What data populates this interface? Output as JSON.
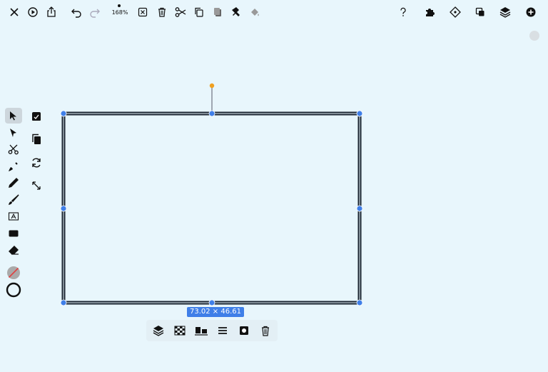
{
  "toolbar": {
    "zoom_label": "168%",
    "left_icons": [
      "close-icon",
      "play-icon",
      "share-icon"
    ],
    "history_icons": [
      "undo-icon",
      "redo-icon"
    ],
    "edit_icons": [
      "delete-selection-icon",
      "trash-icon",
      "scissors-icon",
      "copy-icon",
      "paste-icon",
      "stamp-icon",
      "fill-bucket-icon"
    ],
    "right_icons": [
      "help-icon",
      "puzzle-icon",
      "snap-icon",
      "arrange-icon",
      "layers-icon",
      "add-icon"
    ]
  },
  "tools": {
    "main": [
      "select-arrow-icon",
      "direct-select-icon",
      "scissors-tool-icon",
      "pen-tool-icon",
      "pencil-tool-icon",
      "brush-tool-icon",
      "text-tool-icon",
      "rectangle-tool-icon",
      "eraser-tool-icon"
    ],
    "selected": "select-arrow-icon",
    "secondary": [
      "store-icon",
      "duplicate-icon",
      "rotate-icon",
      "resize-icon"
    ],
    "fill_color": "none",
    "stroke_color": "#111111"
  },
  "selection": {
    "dimensions_label": "73.02 × 46.61",
    "handle_color": "#3f7fe8",
    "rotate_handle_color": "#f0a020"
  },
  "shape": {
    "type": "rectangle",
    "stroke_color": "#1a2430"
  },
  "context_bar": {
    "icons": [
      "layer-order-icon",
      "transparency-icon",
      "align-icon",
      "distribute-icon",
      "mask-icon",
      "delete-icon"
    ]
  },
  "colors": {
    "background": "#e8f6fc",
    "accent": "#3f7fe8"
  }
}
